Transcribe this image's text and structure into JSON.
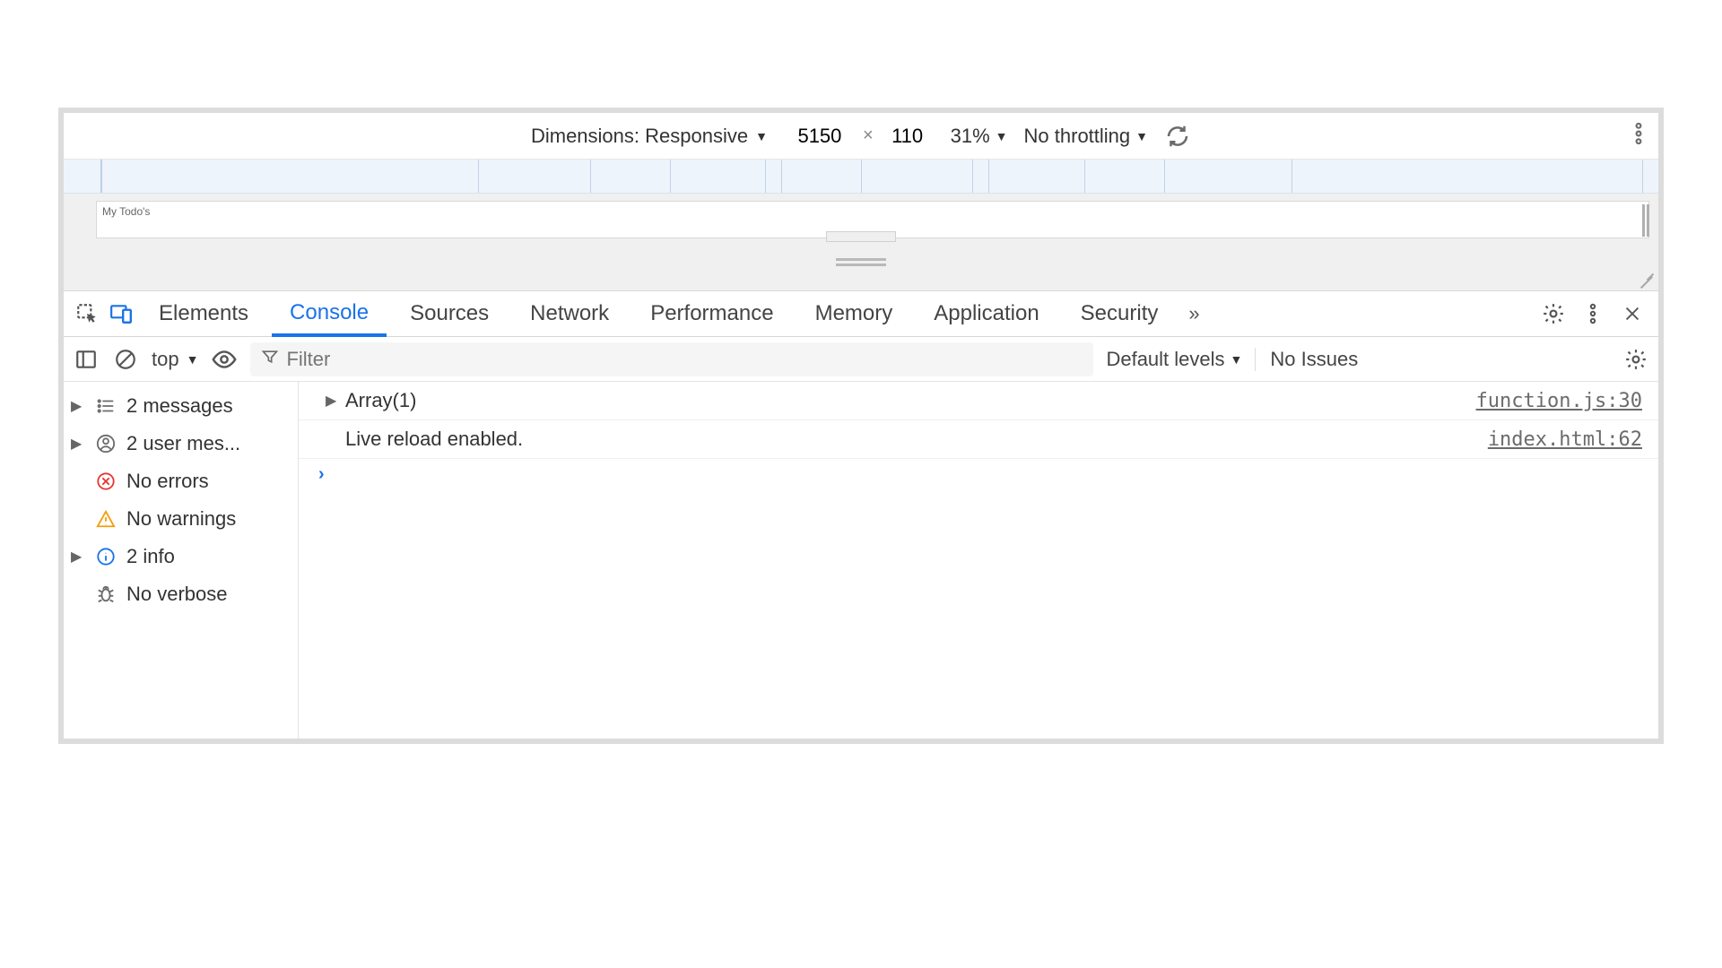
{
  "device_toolbar": {
    "dimensions_label": "Dimensions: Responsive",
    "width": "5150",
    "height": "110",
    "zoom": "31%",
    "throttling": "No throttling"
  },
  "preview": {
    "page_title": "My Todo's"
  },
  "devtools_tabs": {
    "items": [
      "Elements",
      "Console",
      "Sources",
      "Network",
      "Performance",
      "Memory",
      "Application",
      "Security"
    ],
    "active": "Console"
  },
  "console_toolbar": {
    "context": "top",
    "filter_placeholder": "Filter",
    "levels": "Default levels",
    "issues": "No Issues"
  },
  "sidebar": {
    "messages": "2 messages",
    "user_messages": "2 user mes...",
    "errors": "No errors",
    "warnings": "No warnings",
    "info": "2 info",
    "verbose": "No verbose"
  },
  "console_messages": [
    {
      "caret": true,
      "text": "Array(1)",
      "source": "function.js:30"
    },
    {
      "caret": false,
      "text": "Live reload enabled.",
      "source": "index.html:62"
    }
  ]
}
